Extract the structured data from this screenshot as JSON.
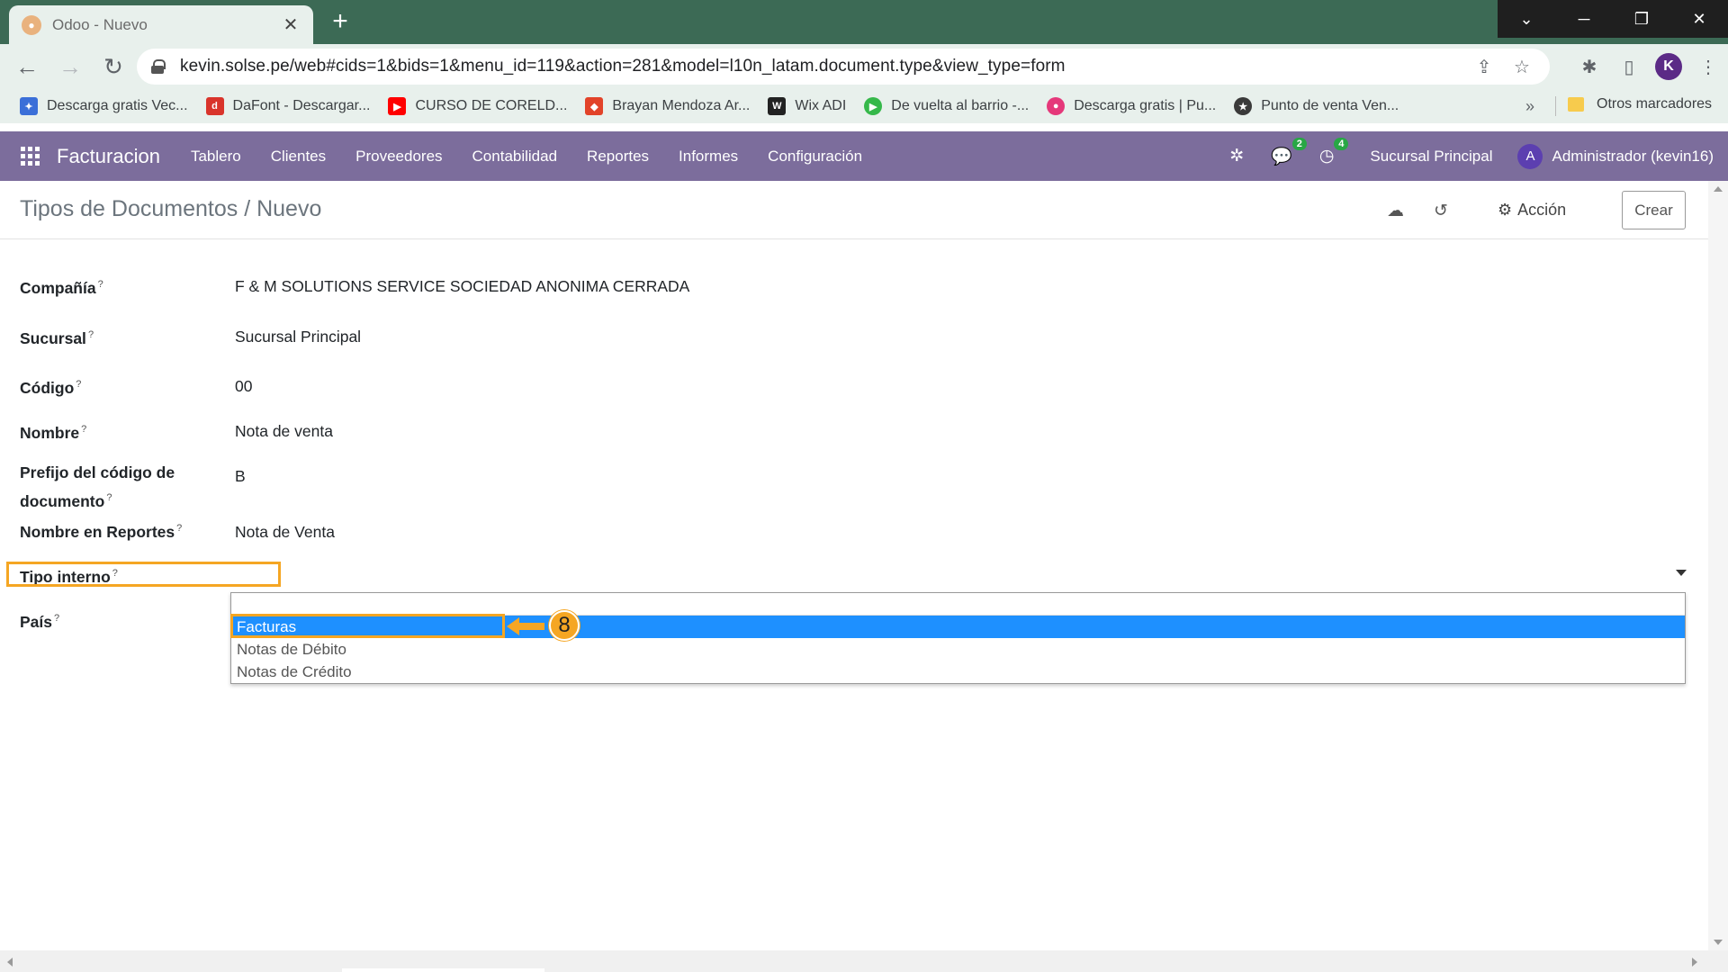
{
  "browser": {
    "tab_title": "Odoo - Nuevo",
    "tab_close": "✕",
    "new_tab": "+",
    "url": "kevin.solse.pe/web#cids=1&bids=1&menu_id=119&action=281&model=l10n_latam.document.type&view_type=form",
    "profile_initial": "K",
    "bookmarks": [
      {
        "label": "Descarga gratis Vec...",
        "icon": "vector-icon",
        "color": "#3b6fd8"
      },
      {
        "label": "DaFont - Descargar...",
        "icon": "dafont-icon",
        "color": "#d9342b"
      },
      {
        "label": "CURSO DE CORELD...",
        "icon": "youtube-icon",
        "color": "#ff0000"
      },
      {
        "label": "Brayan Mendoza Ar...",
        "icon": "gitlab-icon",
        "color": "#e24329"
      },
      {
        "label": "Wix ADI",
        "icon": "wix-icon",
        "color": "#222222"
      },
      {
        "label": "De vuelta al barrio -...",
        "icon": "play-icon",
        "color": "#35b84a"
      },
      {
        "label": "Descarga gratis | Pu...",
        "icon": "drop-icon",
        "color": "#e5387a"
      },
      {
        "label": "Punto de venta Ven...",
        "icon": "star-badge-icon",
        "color": "#3a3a3a"
      }
    ],
    "bookmarks_more": "»",
    "other_bookmarks": "Otros marcadores"
  },
  "odoo_nav": {
    "brand": "Facturacion",
    "menu": [
      "Tablero",
      "Clientes",
      "Proveedores",
      "Contabilidad",
      "Reportes",
      "Informes",
      "Configuración"
    ],
    "messages_count": "2",
    "activities_count": "4",
    "branch": "Sucursal Principal",
    "user_initial": "A",
    "user_name": "Administrador (kevin16)"
  },
  "control_panel": {
    "breadcrumb": "Tipos de Documentos / Nuevo",
    "action_label": "Acción",
    "create_label": "Crear"
  },
  "form": {
    "fields": [
      {
        "label": "Compañía",
        "value": "F & M SOLUTIONS SERVICE SOCIEDAD ANONIMA CERRADA"
      },
      {
        "label": "Sucursal",
        "value": "Sucursal Principal"
      },
      {
        "label": "Código",
        "value": "00"
      },
      {
        "label": "Nombre",
        "value": "Nota de venta"
      },
      {
        "label": "Prefijo del código de",
        "label2": "documento",
        "value": "B"
      },
      {
        "label": "Nombre en Reportes",
        "value": "Nota de Venta"
      },
      {
        "label": "Tipo interno",
        "value": ""
      },
      {
        "label": "País",
        "value": ""
      }
    ],
    "help_mark": "?",
    "dropdown_options": [
      "Facturas",
      "Notas de Débito",
      "Notas de Crédito"
    ],
    "selected_option": "Facturas",
    "callout_number": "8"
  },
  "colors": {
    "odoo_nav": "#7c6d9c",
    "highlight": "#f5a623",
    "selection": "#1e90ff",
    "tabstrip": "#3c6a55"
  }
}
